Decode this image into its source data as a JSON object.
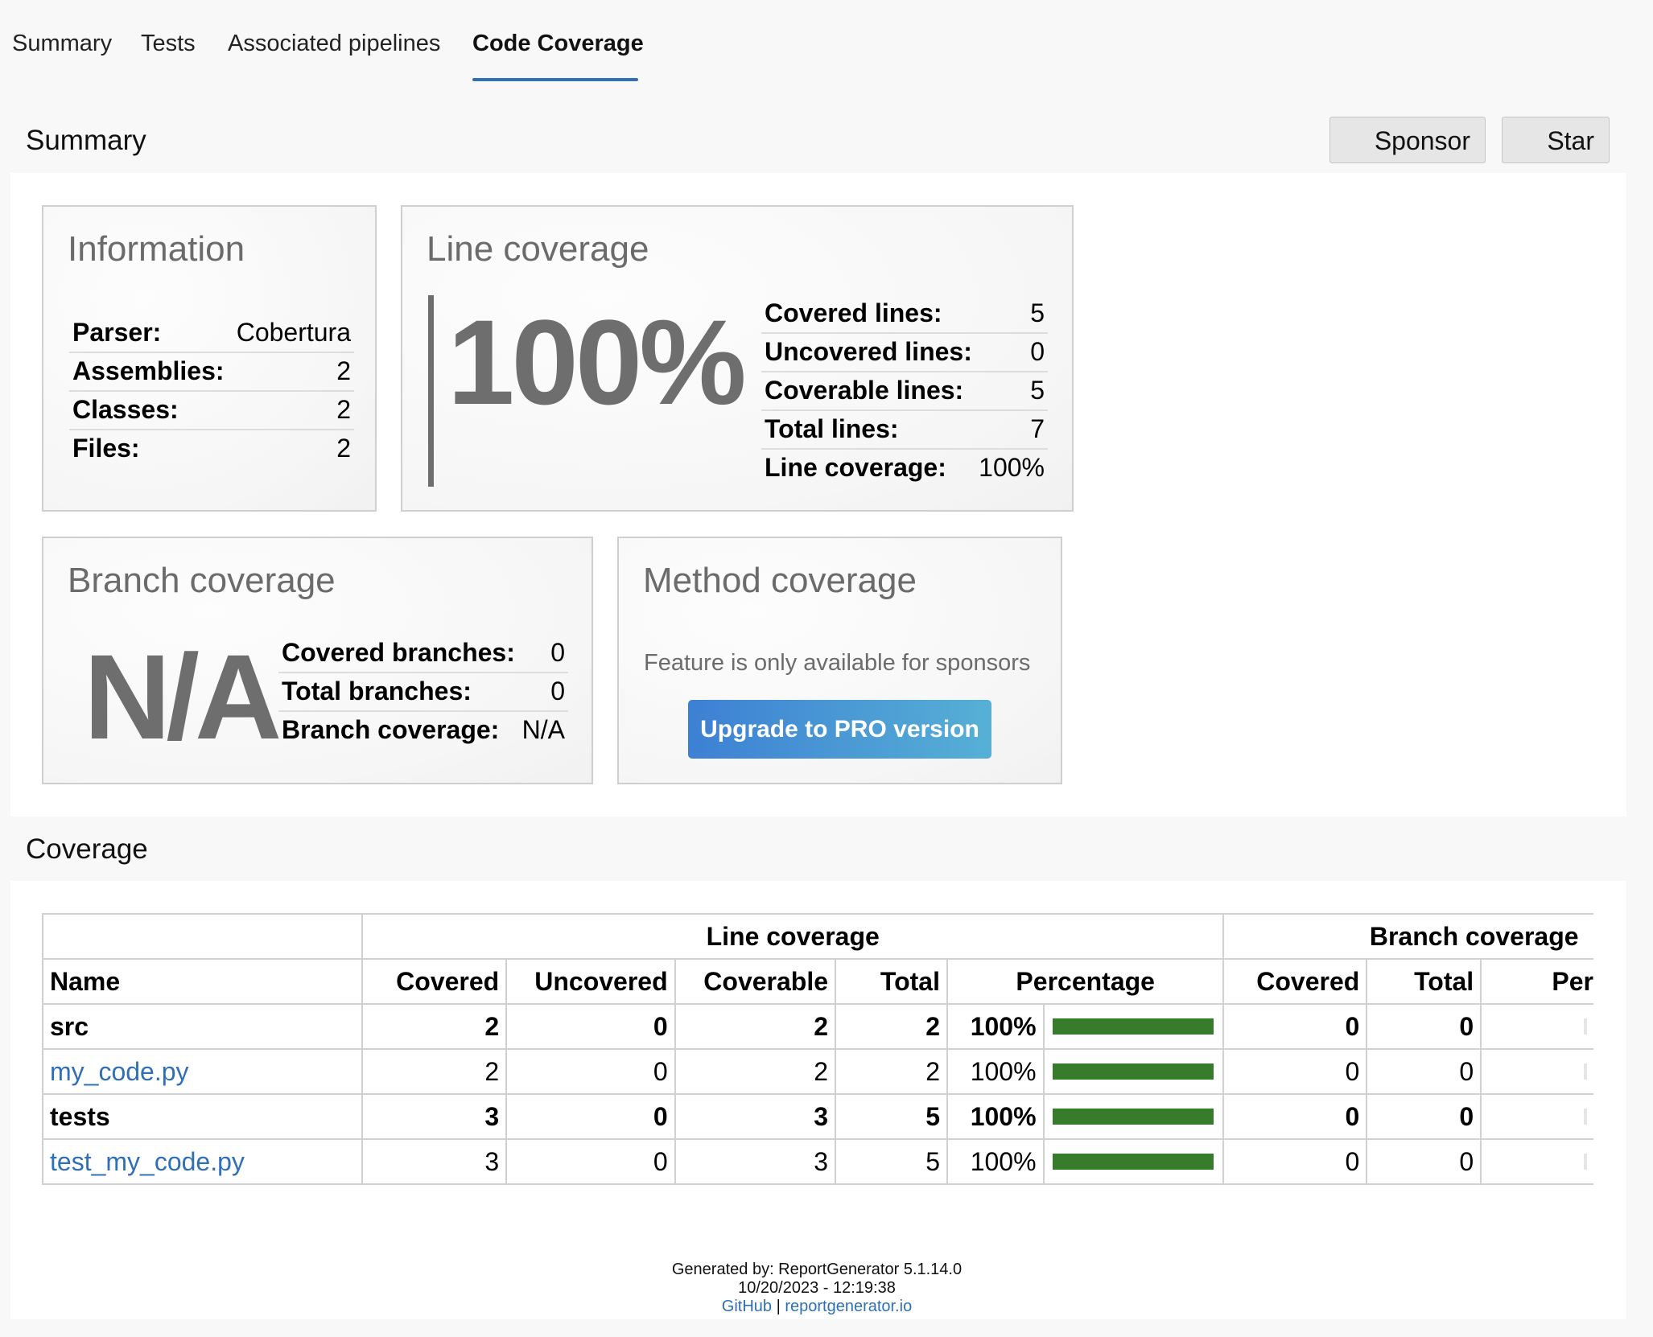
{
  "tabs": [
    {
      "label": "Summary"
    },
    {
      "label": "Tests"
    },
    {
      "label": "Associated pipelines"
    },
    {
      "label": "Code Coverage"
    }
  ],
  "active_tab": "Code Coverage",
  "summary": {
    "title": "Summary",
    "sponsor_label": "Sponsor",
    "star_label": "Star"
  },
  "information": {
    "title": "Information",
    "rows": [
      {
        "label": "Parser:",
        "value": "Cobertura"
      },
      {
        "label": "Assemblies:",
        "value": "2"
      },
      {
        "label": "Classes:",
        "value": "2"
      },
      {
        "label": "Files:",
        "value": "2"
      }
    ]
  },
  "line_coverage": {
    "title": "Line coverage",
    "big_value": "100%",
    "rows": [
      {
        "label": "Covered lines:",
        "value": "5"
      },
      {
        "label": "Uncovered lines:",
        "value": "0"
      },
      {
        "label": "Coverable lines:",
        "value": "5"
      },
      {
        "label": "Total lines:",
        "value": "7"
      },
      {
        "label": "Line coverage:",
        "value": "100%"
      }
    ]
  },
  "branch_coverage": {
    "title": "Branch coverage",
    "big_value": "N/A",
    "rows": [
      {
        "label": "Covered branches:",
        "value": "0"
      },
      {
        "label": "Total branches:",
        "value": "0"
      },
      {
        "label": "Branch coverage:",
        "value": "N/A"
      }
    ]
  },
  "method_coverage": {
    "title": "Method coverage",
    "note": "Feature is only available for sponsors",
    "upgrade_label": "Upgrade to PRO version"
  },
  "coverage": {
    "title": "Coverage",
    "group_headers": {
      "line": "Line coverage",
      "branch": "Branch coverage"
    },
    "columns": [
      "Name",
      "Covered",
      "Uncovered",
      "Coverable",
      "Total",
      "Percentage",
      "Covered",
      "Total",
      "Per"
    ],
    "rows": [
      {
        "name": "src",
        "type": "group",
        "covered": "2",
        "uncovered": "0",
        "coverable": "2",
        "total": "2",
        "percentage": "100%",
        "percent_value": 100,
        "b_covered": "0",
        "b_total": "0"
      },
      {
        "name": "my_code.py",
        "type": "file",
        "covered": "2",
        "uncovered": "0",
        "coverable": "2",
        "total": "2",
        "percentage": "100%",
        "percent_value": 100,
        "b_covered": "0",
        "b_total": "0"
      },
      {
        "name": "tests",
        "type": "group",
        "covered": "3",
        "uncovered": "0",
        "coverable": "3",
        "total": "5",
        "percentage": "100%",
        "percent_value": 100,
        "b_covered": "0",
        "b_total": "0"
      },
      {
        "name": "test_my_code.py",
        "type": "file",
        "covered": "3",
        "uncovered": "0",
        "coverable": "3",
        "total": "5",
        "percentage": "100%",
        "percent_value": 100,
        "b_covered": "0",
        "b_total": "0"
      }
    ]
  },
  "footer": {
    "generated_by": "Generated by: ReportGenerator 5.1.14.0",
    "timestamp": "10/20/2023 - 12:19:38",
    "github_label": "GitHub",
    "separator": "|",
    "site_label": "reportgenerator.io"
  },
  "colors": {
    "accent": "#2f6fb7",
    "coverage_bar": "#367c2b",
    "pro_gradient_start": "#3d80d4",
    "pro_gradient_end": "#56b0d5"
  }
}
